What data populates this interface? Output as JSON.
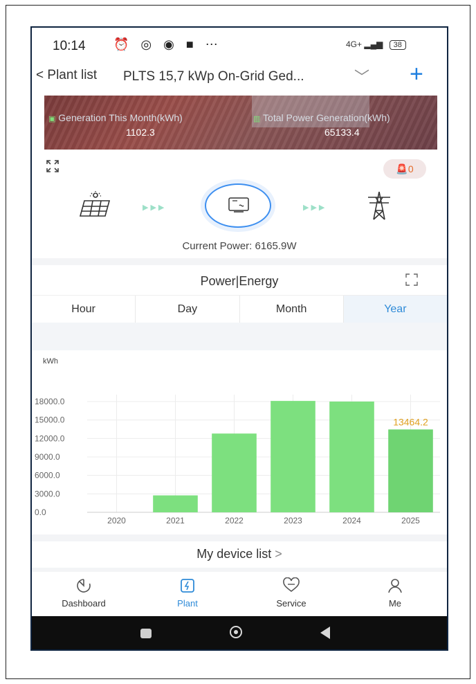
{
  "status": {
    "time": "10:14",
    "network": "4G+",
    "battery": "38"
  },
  "nav": {
    "back_label": "Plant list",
    "plant_name": "PLTS 15,7 kWp On-Grid Ged...",
    "add_icon": "plus-icon"
  },
  "banner": {
    "gen_month_label": "Generation This Month(kWh)",
    "gen_month_value": "1102.3",
    "total_gen_label": "Total Power Generation(kWh)",
    "total_gen_value": "65133.4"
  },
  "alarm_count": "0",
  "flow": {
    "current_power": "Current Power: 6165.9W"
  },
  "section_title": "Power|Energy",
  "tabs": [
    "Hour",
    "Day",
    "Month",
    "Year"
  ],
  "active_tab": "Year",
  "chart_data": {
    "type": "bar",
    "ylabel": "kWh",
    "categories": [
      "2020",
      "2021",
      "2022",
      "2023",
      "2024",
      "2025"
    ],
    "values": [
      0,
      2750,
      12800,
      18100,
      18000,
      13464.2
    ],
    "highlight_label": "13464.2",
    "y_ticks": [
      "0.0",
      "3000.0",
      "6000.0",
      "9000.0",
      "12000.0",
      "15000.0",
      "18000.0"
    ],
    "ylim": [
      0,
      18000
    ],
    "bar_color": "#7de07f",
    "grid": true
  },
  "device_list_label": "My device list",
  "bottom_nav": [
    {
      "label": "Dashboard",
      "icon": "dashboard-icon"
    },
    {
      "label": "Plant",
      "icon": "plant-icon"
    },
    {
      "label": "Service",
      "icon": "service-icon"
    },
    {
      "label": "Me",
      "icon": "profile-icon"
    }
  ],
  "colors": {
    "accent": "#2f8bd8",
    "alarm": "#e46a2a",
    "bar": "#7de07f",
    "highlight_text": "#e0a020"
  }
}
